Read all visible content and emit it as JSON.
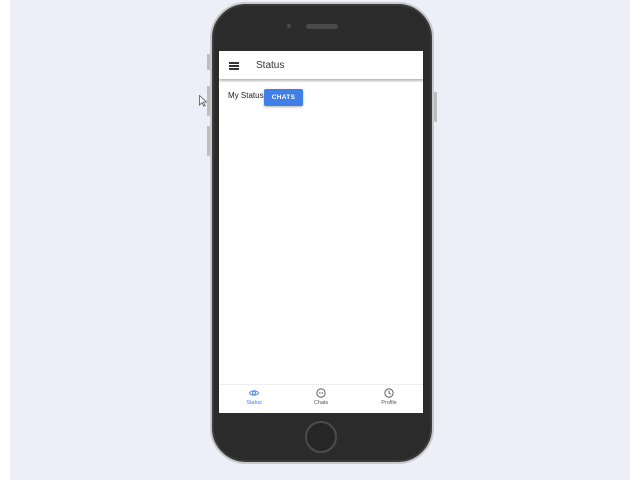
{
  "app": {
    "title": "Status"
  },
  "content": {
    "status_label": "My Status",
    "chats_button_label": "CHATS"
  },
  "bottom_nav": {
    "items": [
      {
        "label": "Status",
        "icon": "eye-icon",
        "active": true
      },
      {
        "label": "Chats",
        "icon": "chat-bubble-icon",
        "active": false
      },
      {
        "label": "Profile",
        "icon": "profile-icon",
        "active": false
      }
    ]
  },
  "colors": {
    "accent": "#3f7fe6",
    "background": "#eceff7",
    "phone_body": "#2b2b2b"
  }
}
